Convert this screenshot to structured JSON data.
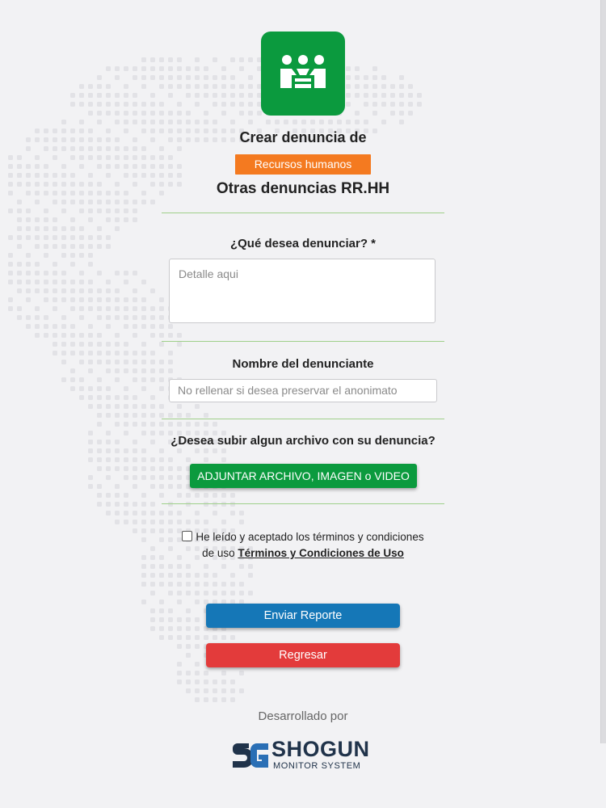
{
  "header": {
    "title_prefix": "Crear denuncia de",
    "category": "Recursos humanos",
    "subtitle": "Otras denuncias RR.HH"
  },
  "form": {
    "report_label": "¿Qué desea denunciar? *",
    "report_placeholder": "Detalle aqui",
    "name_label": "Nombre del denunciante",
    "name_placeholder": "No rellenar si desea preservar el anonimato",
    "upload_label": "¿Desea subir algun archivo con su denuncia?",
    "upload_button": "ADJUNTAR ARCHIVO, IMAGEN o VIDEO",
    "terms_text": "He leído y aceptado los términos y condiciones de uso",
    "terms_link": "Términos y Condiciones de Uso",
    "terms_checked": false,
    "submit_button": "Enviar Reporte",
    "back_button": "Regresar"
  },
  "footer": {
    "developed_by": "Desarrollado por",
    "brand_name": "SHOGUN",
    "brand_sub": "MONITOR SYSTEM"
  },
  "colors": {
    "logo_green": "#0b9a3e",
    "category_orange": "#f47a20",
    "submit_blue": "#1577b7",
    "back_red": "#e33b3b",
    "divider_green": "#9fd08a",
    "brand_navy": "#20334a"
  },
  "icons": {
    "app_logo": "people-meeting-icon",
    "brand_logo": "sg-monogram-icon"
  }
}
